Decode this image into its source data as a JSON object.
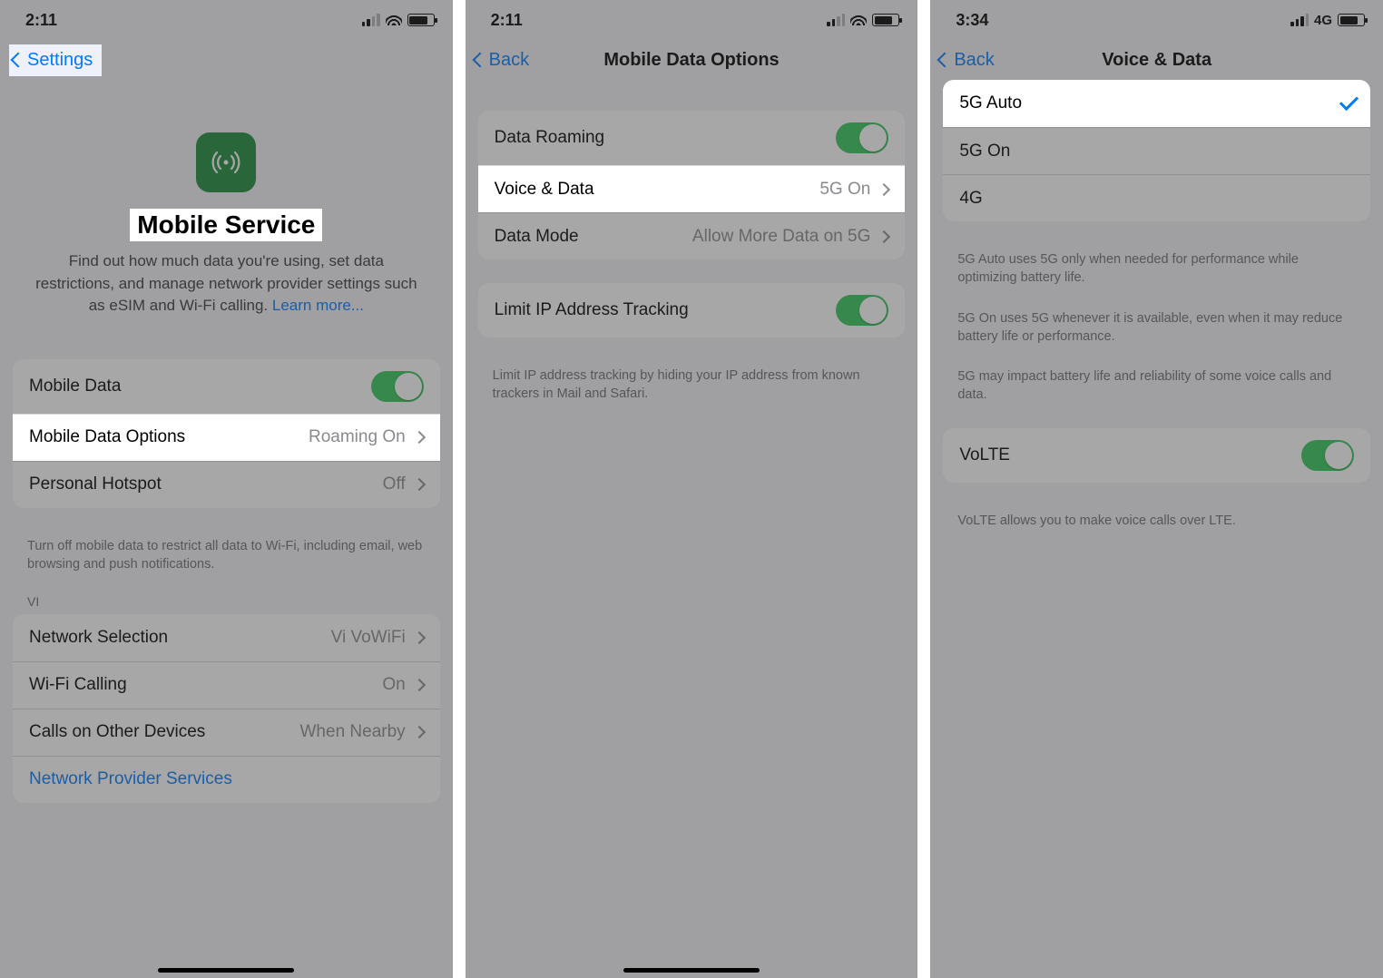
{
  "screen1": {
    "time": "2:11",
    "nav_back": "Settings",
    "hero_title": "Mobile Service",
    "hero_desc_a": "Find out how much data you're using, set data restrictions, and manage network provider settings such as eSIM and Wi-Fi calling. ",
    "hero_link": "Learn more...",
    "rows": {
      "mobile_data": "Mobile Data",
      "mobile_data_options": "Mobile Data Options",
      "mobile_data_options_val": "Roaming On",
      "personal_hotspot": "Personal Hotspot",
      "personal_hotspot_val": "Off"
    },
    "footer1": "Turn off mobile data to restrict all data to Wi-Fi, including email, web browsing and push notifications.",
    "section_vi": "VI",
    "rows2": {
      "network_selection": "Network Selection",
      "network_selection_val": "Vi VoWiFi",
      "wifi_calling": "Wi-Fi Calling",
      "wifi_calling_val": "On",
      "calls_other": "Calls on Other Devices",
      "calls_other_val": "When Nearby",
      "provider_services": "Network Provider Services"
    }
  },
  "screen2": {
    "time": "2:11",
    "nav_back": "Back",
    "nav_title": "Mobile Data Options",
    "rows": {
      "data_roaming": "Data Roaming",
      "voice_data": "Voice & Data",
      "voice_data_val": "5G On",
      "data_mode": "Data Mode",
      "data_mode_val": "Allow More Data on 5G"
    },
    "rows2": {
      "limit_ip": "Limit IP Address Tracking"
    },
    "footer1": "Limit IP address tracking by hiding your IP address from known trackers in Mail and Safari."
  },
  "screen3": {
    "time": "3:34",
    "net_label": "4G",
    "nav_back": "Back",
    "nav_title": "Voice & Data",
    "options": {
      "auto": "5G Auto",
      "on": "5G On",
      "fourg": "4G"
    },
    "footer1": "5G Auto uses 5G only when needed for performance while optimizing battery life.",
    "footer2": "5G On uses 5G whenever it is available, even when it may reduce battery life or performance.",
    "footer3": "5G may impact battery life and reliability of some voice calls and data.",
    "volte": "VoLTE",
    "volte_footer": "VoLTE allows you to make voice calls over LTE."
  }
}
